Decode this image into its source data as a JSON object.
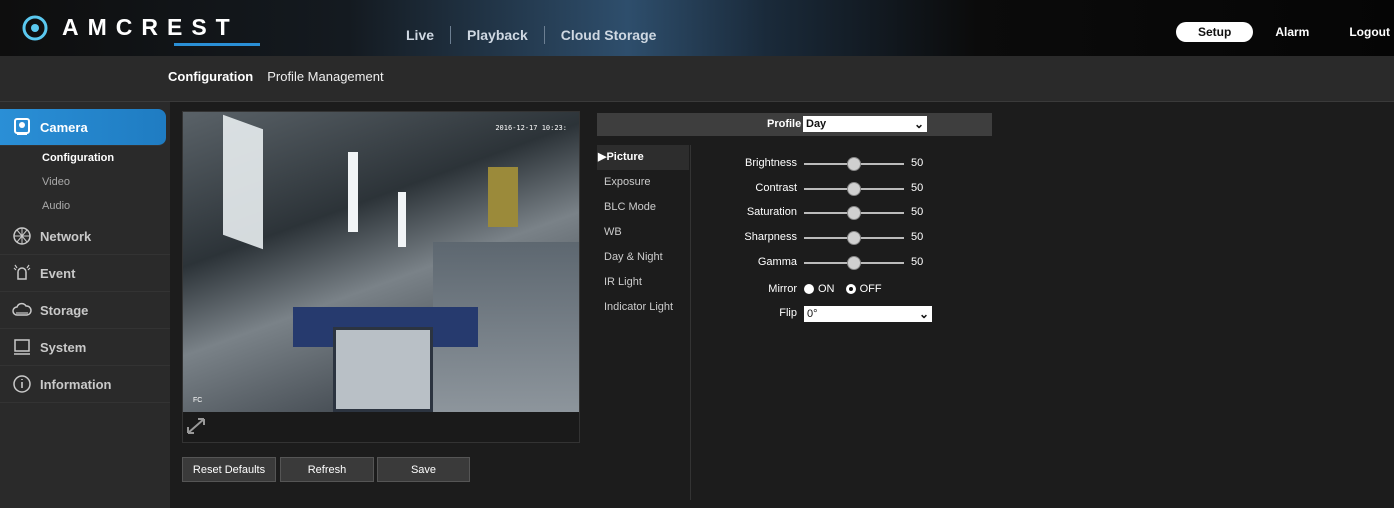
{
  "brand": {
    "name": "AMCREST"
  },
  "topnav": {
    "live": "Live",
    "playback": "Playback",
    "cloud": "Cloud Storage"
  },
  "topright": {
    "setup": "Setup",
    "alarm": "Alarm",
    "logout": "Logout"
  },
  "tabs": {
    "configuration": "Configuration",
    "profile": "Profile Management"
  },
  "sidebar": {
    "camera": "Camera",
    "sub": [
      "Configuration",
      "Video",
      "Audio"
    ],
    "network": "Network",
    "event": "Event",
    "storage": "Storage",
    "system": "System",
    "information": "Information"
  },
  "preview": {
    "timestamp": "2016-12-17 10:23:",
    "tag": "FC"
  },
  "buttons": {
    "reset": "Reset Defaults",
    "refresh": "Refresh",
    "save": "Save"
  },
  "profile": {
    "label": "Profile",
    "value": "Day"
  },
  "menu": [
    "Picture",
    "Exposure",
    "BLC Mode",
    "WB",
    "Day & Night",
    "IR Light",
    "Indicator Light"
  ],
  "settings": {
    "brightness": {
      "label": "Brightness",
      "value": "50",
      "level": 0.5
    },
    "contrast": {
      "label": "Contrast",
      "value": "50",
      "level": 0.5
    },
    "saturation": {
      "label": "Saturation",
      "value": "50",
      "level": 0.5
    },
    "sharpness": {
      "label": "Sharpness",
      "value": "50",
      "level": 0.5
    },
    "gamma": {
      "label": "Gamma",
      "value": "50",
      "level": 0.5
    },
    "mirror": {
      "label": "Mirror",
      "on": "ON",
      "off": "OFF",
      "selected": "OFF"
    },
    "flip": {
      "label": "Flip",
      "value": "0°"
    }
  },
  "colors": {
    "accent": "#2a8fd6"
  }
}
